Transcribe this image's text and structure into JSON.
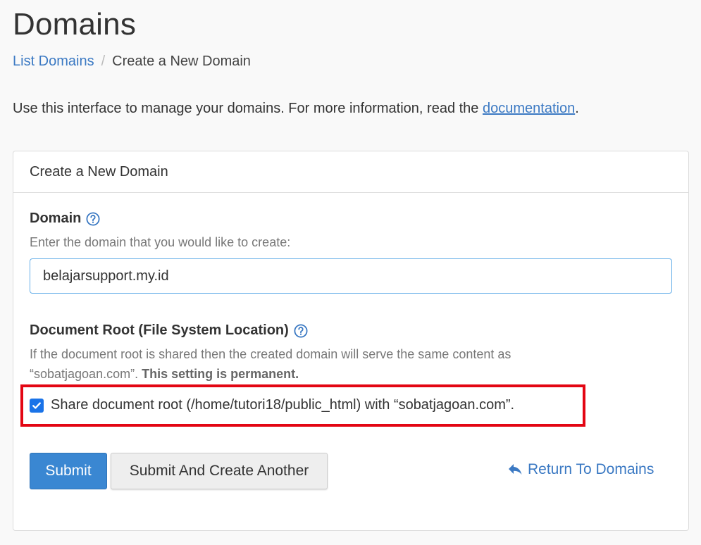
{
  "page": {
    "title": "Domains"
  },
  "breadcrumb": {
    "items": [
      {
        "label": "List Domains"
      },
      {
        "label": "Create a New Domain"
      }
    ],
    "separator": "/"
  },
  "intro": {
    "text": "Use this interface to manage your domains. For more information, read the ",
    "link_label": "documentation",
    "suffix": "."
  },
  "panel": {
    "title": "Create a New Domain",
    "domain": {
      "label": "Domain",
      "help_icon": "question-circle-icon",
      "help": "Enter the domain that you would like to create:",
      "value": "belajarsupport.my.id"
    },
    "docroot": {
      "label": "Document Root (File System Location)",
      "help_icon": "question-circle-icon",
      "help_line1": "If the document root is shared then the created domain will serve the same content as",
      "help_line2": "“sobatjagoan.com”.",
      "help_bold": "This setting is permanent.",
      "share_checked": true,
      "share_label": "Share document root (/home/tutori18/public_html) with “sobatjagoan.com”."
    },
    "buttons": {
      "submit": "Submit",
      "submit_another": "Submit And Create Another",
      "return": "Return To Domains",
      "return_icon": "reply-arrow-icon"
    }
  },
  "colors": {
    "link": "#3b79c3",
    "primary": "#3a87d2",
    "highlight": "#e30613",
    "checkbox": "#1a73e8"
  }
}
